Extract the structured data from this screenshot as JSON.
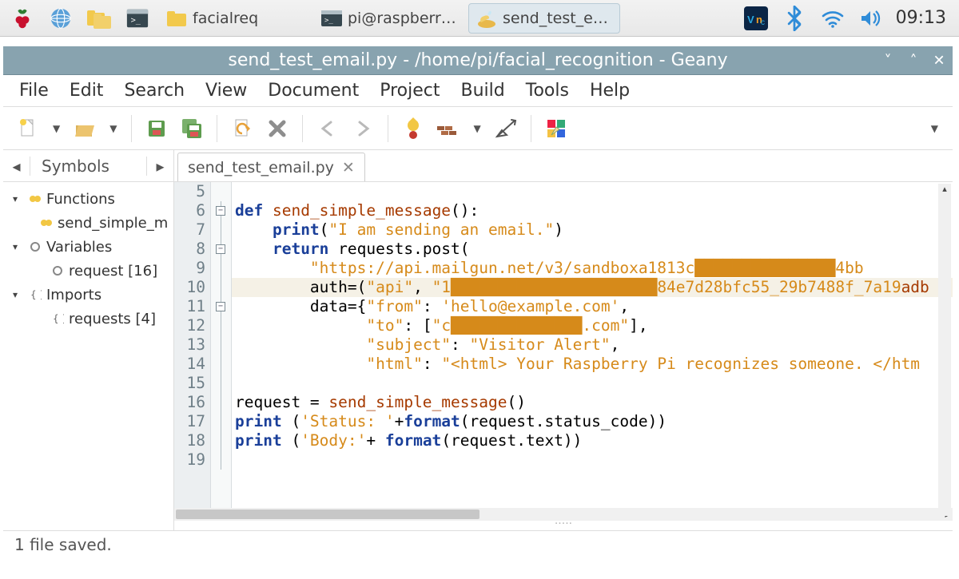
{
  "os_panel": {
    "tasks": [
      {
        "label": "facialreq",
        "icon": "folder"
      },
      {
        "label": "pi@raspberr…",
        "icon": "terminal"
      },
      {
        "label": "send_test_e…",
        "icon": "lamp",
        "active": true
      }
    ],
    "tray": {
      "clock": "09:13"
    }
  },
  "window": {
    "title": "send_test_email.py - /home/pi/facial_recognition - Geany"
  },
  "menubar": [
    "File",
    "Edit",
    "Search",
    "View",
    "Document",
    "Project",
    "Build",
    "Tools",
    "Help"
  ],
  "sidebar": {
    "tab": "Symbols",
    "tree": [
      {
        "level": 1,
        "caret": "▾",
        "icon": "fn",
        "label": "Functions"
      },
      {
        "level": 2,
        "icon": "fn",
        "label": "send_simple_m"
      },
      {
        "level": 1,
        "caret": "▾",
        "icon": "var",
        "label": "Variables"
      },
      {
        "level": 2,
        "icon": "var",
        "label": "request [16]"
      },
      {
        "level": 1,
        "caret": "▾",
        "icon": "imp",
        "label": "Imports"
      },
      {
        "level": 2,
        "icon": "imp",
        "label": "requests [4]"
      }
    ]
  },
  "editor": {
    "tab": "send_test_email.py",
    "first_line": 5,
    "lines": [
      {
        "n": 5,
        "raw": ""
      },
      {
        "n": 6,
        "raw": "<kw>def</kw> <fn>send_simple_message</fn>():",
        "fold": "-"
      },
      {
        "n": 7,
        "raw": "    <kw>print</kw>(<str>\"I am sending an email.\"</str>)"
      },
      {
        "n": 8,
        "raw": "    <kw>return</kw> requests.post(",
        "fold": "-"
      },
      {
        "n": 9,
        "raw": "        <str>\"https://api.mailgun.net/v3/sandboxa1813c███████████████4bb</str>"
      },
      {
        "n": 10,
        "raw": "        auth=(<str>\"api\"</str>, <str>\"1██████████████████████84e7d28bfc55_29b7488f_7a19</str><fn>adb</fn>",
        "hl": true
      },
      {
        "n": 11,
        "raw": "        data={<str>\"from\"</str>: <str>'hello@example.com'</str>,",
        "fold": "-"
      },
      {
        "n": 12,
        "raw": "              <str>\"to\"</str>: [<str>\"c██████████████.com\"</str>],"
      },
      {
        "n": 13,
        "raw": "              <str>\"subject\"</str>: <str>\"Visitor Alert\"</str>,"
      },
      {
        "n": 14,
        "raw": "              <str>\"html\"</str>: <str>\"&lt;html&gt; Your Raspberry Pi recognizes someone. &lt;/htm</str>"
      },
      {
        "n": 15,
        "raw": ""
      },
      {
        "n": 16,
        "raw": "request = <fn>send_simple_message</fn>()"
      },
      {
        "n": 17,
        "raw": "<kw>print</kw> (<str>'Status: '</str>+<kw>format</kw>(request.status_code))"
      },
      {
        "n": 18,
        "raw": "<kw>print</kw> (<str>'Body:'</str>+ <kw>format</kw>(request.text))"
      },
      {
        "n": 19,
        "raw": ""
      }
    ]
  },
  "status": "1 file saved."
}
